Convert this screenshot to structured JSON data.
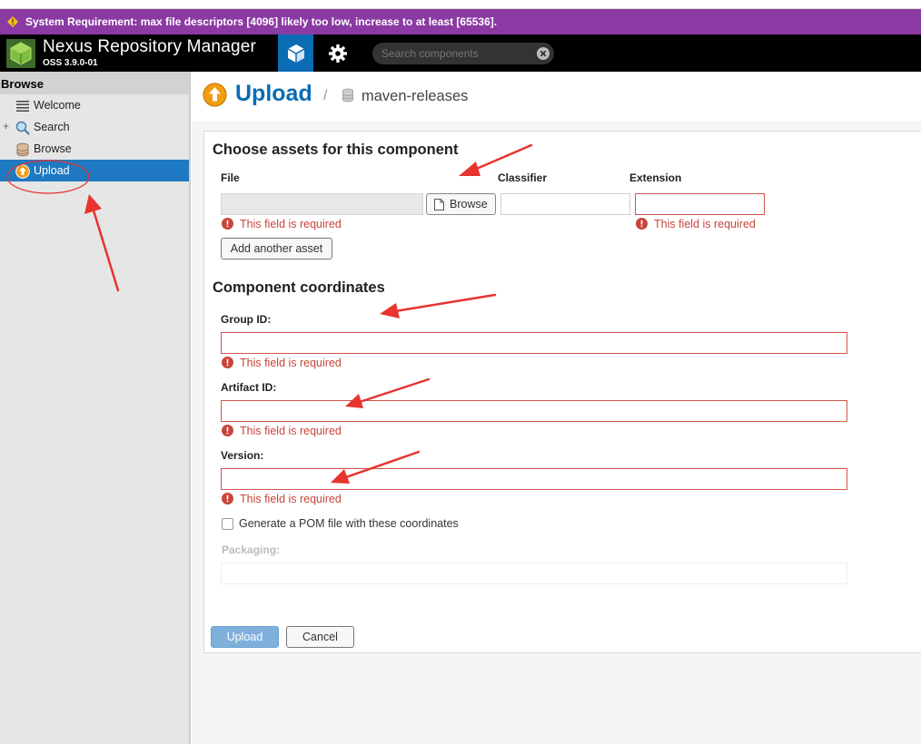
{
  "warning": {
    "text": "System Requirement: max file descriptors [4096] likely too low, increase to at least [65536].",
    "icon": "warning-icon",
    "color": "#8b3aa3"
  },
  "header": {
    "app_name": "Nexus Repository Manager",
    "version": "OSS 3.9.0-01",
    "search_placeholder": "Search components",
    "accent_color": "#0a6cb4"
  },
  "sidebar": {
    "title": "Browse",
    "items": [
      {
        "label": "Welcome",
        "icon": "list-icon"
      },
      {
        "label": "Search",
        "icon": "magnifier-icon",
        "expander": "+"
      },
      {
        "label": "Browse",
        "icon": "database-icon"
      },
      {
        "label": "Upload",
        "icon": "upload-icon",
        "selected": true
      }
    ]
  },
  "page": {
    "title": "Upload",
    "separator": "/",
    "repository": "maven-releases"
  },
  "assets": {
    "section_title": "Choose assets for this component",
    "file_label": "File",
    "classifier_label": "Classifier",
    "extension_label": "Extension",
    "browse_label": "Browse",
    "file_error": "This field is required",
    "extension_error": "This field is required",
    "add_asset_label": "Add another asset"
  },
  "coords": {
    "section_title": "Component coordinates",
    "group_label": "Group ID:",
    "group_error": "This field is required",
    "artifact_label": "Artifact ID:",
    "artifact_error": "This field is required",
    "version_label": "Version:",
    "version_error": "This field is required",
    "pom_checkbox_label": "Generate a POM file with these coordinates",
    "packaging_label": "Packaging:"
  },
  "actions": {
    "upload_label": "Upload",
    "cancel_label": "Cancel"
  },
  "annotations": {
    "color": "#e8332e"
  }
}
